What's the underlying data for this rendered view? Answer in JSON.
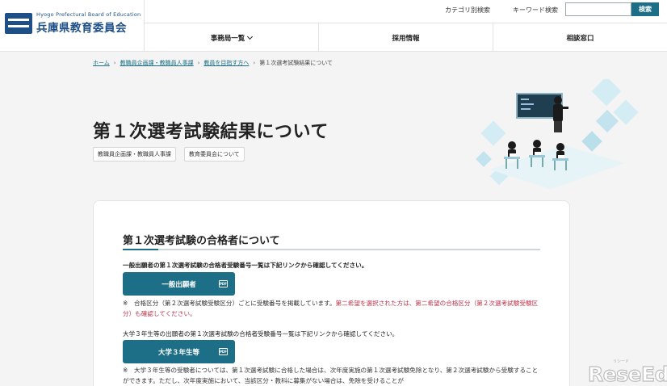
{
  "header": {
    "logo_en": "Hyogo Prefectural Board of Education",
    "logo_ja": "兵庫県教育委員会",
    "category_search": "カテゴリ別検索",
    "keyword_search_label": "キーワード検索",
    "search_input_value": "",
    "search_button": "検索"
  },
  "nav": {
    "items": [
      {
        "label": "事務局一覧",
        "has_dropdown": true
      },
      {
        "label": "採用情報"
      },
      {
        "label": "相談窓口"
      }
    ]
  },
  "breadcrumb": {
    "items": [
      "ホーム",
      "教職員企画課・教職員人事課",
      "教員を目指す方へ",
      "第１次選考試験結果について"
    ]
  },
  "page": {
    "title": "第１次選考試験結果について",
    "tags": [
      "教職員企画課・教職員人事課",
      "教育委員会について"
    ]
  },
  "content": {
    "section_title": "第１次選考試験の合格者について",
    "intro": "一般出願者の第１次選考試験の合格者受験番号一覧は下記リンクから確認してください。",
    "button_general": "一般出願者",
    "note1_a": "※　合格区分（第２次選考試験受験区分）ごとに受験番号を掲載しています。",
    "note1_b": "第二希望を選択された方は、第二希望の合格区分（第２次選考試験受験区分）も確認してください。",
    "intro2": "大学３年生等の出願者の第１次選考試験の合格者受験番号一覧は下記リンクから確認してください。",
    "button_univ": "大学３年生等",
    "note2": "※　大学３年生等の受験者については、第１次選考試験に合格した場合は、次年度実施の第１次選考試験免除となり、第２次選考試験から受験することができます。ただし、次年度実施において、当該区分・教科に募集がない場合は、免除を受けることが"
  },
  "icons": {
    "pdf": "pdf-file-icon",
    "chevron": "chevron-down-icon"
  },
  "watermark": {
    "text": "ReseEd",
    "small": "リシード"
  },
  "colors": {
    "brand": "#1e4f86",
    "accent": "#1c6f86",
    "notice": "#c0324a"
  }
}
